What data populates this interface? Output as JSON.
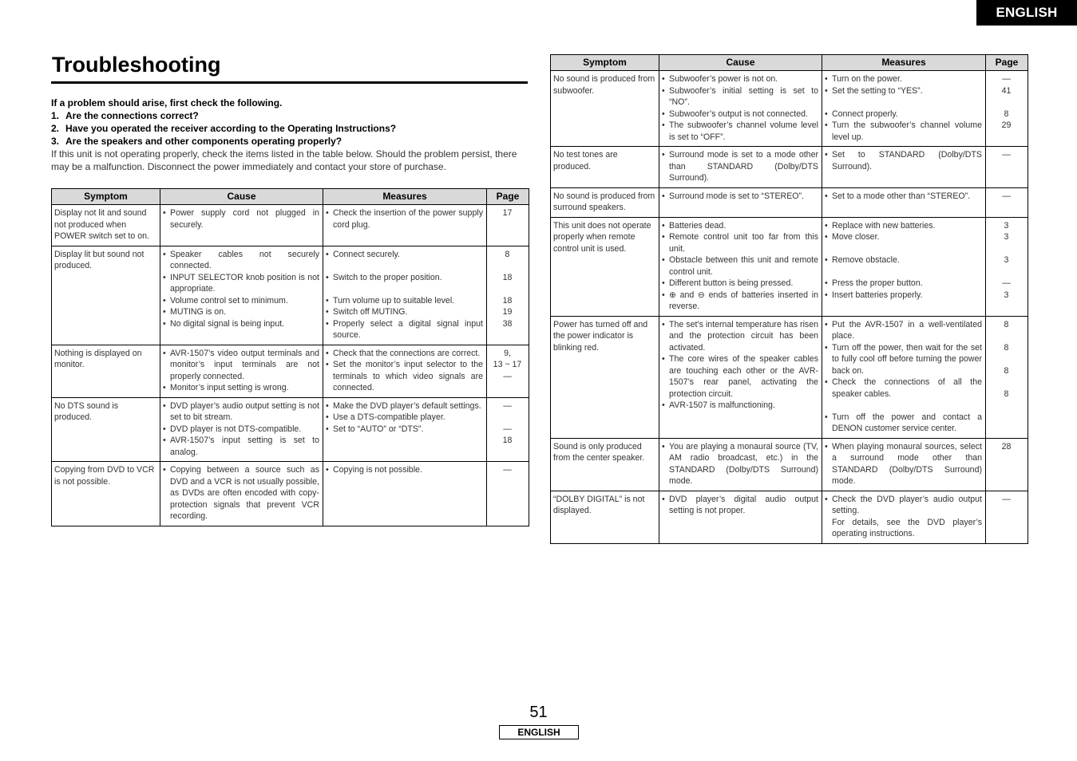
{
  "language_tab": "ENGLISH",
  "title": "Troubleshooting",
  "intro": {
    "lead": "If a problem should arise, first check the following.",
    "checks": [
      {
        "num": "1.",
        "text": "Are the connections correct?"
      },
      {
        "num": "2.",
        "text": "Have you operated the receiver according to the Operating Instructions?"
      },
      {
        "num": "3.",
        "text": "Are the speakers and other components operating properly?"
      }
    ],
    "note": "If this unit is not operating properly, check the items listed in the table below. Should the problem persist, there may be a malfunction. Disconnect the power immediately and contact your store of purchase."
  },
  "table_headers": {
    "symptom": "Symptom",
    "cause": "Cause",
    "measures": "Measures",
    "page": "Page"
  },
  "left_table": [
    {
      "symptom": "Display not lit and sound not produced when POWER switch set to on.",
      "causes": [
        "Power supply cord not plugged in securely."
      ],
      "measures": [
        "Check the insertion of the power supply cord plug."
      ],
      "pages": [
        "17"
      ]
    },
    {
      "symptom": "Display lit but sound not produced.",
      "causes": [
        "Speaker cables not securely connected.",
        "INPUT SELECTOR knob position is not appropriate.",
        "Volume control set to minimum.",
        "MUTING is on.",
        "No digital signal is being input."
      ],
      "measures": [
        "Connect securely.",
        "Switch to the proper position.",
        "Turn volume up to suitable level.",
        "Switch off MUTING.",
        "Properly select a digital signal input source."
      ],
      "pages": [
        "8",
        "18",
        "18",
        "19",
        "38"
      ]
    },
    {
      "symptom": "Nothing is displayed on monitor.",
      "causes": [
        "AVR-1507’s video output terminals and monitor’s input terminals are not properly connected.",
        "Monitor’s input setting is wrong."
      ],
      "measures": [
        "Check that the connections are correct.",
        "Set the monitor’s input selector to the terminals to which video signals are connected."
      ],
      "pages": [
        "9,",
        "13 ~ 17",
        "—"
      ]
    },
    {
      "symptom": "No DTS sound is produced.",
      "causes": [
        "DVD player’s audio output setting is not set to bit stream.",
        "DVD player is not DTS-compatible.",
        "AVR-1507’s input setting is set to analog."
      ],
      "measures": [
        "Make the DVD player’s default settings.",
        "Use a DTS-compatible player.",
        "Set to “AUTO” or “DTS”."
      ],
      "pages": [
        "—",
        "—",
        "18"
      ]
    },
    {
      "symptom": "Copying from DVD to VCR is not possible.",
      "causes": [
        "Copying between a source such as DVD and a VCR is not usually possible, as DVDs are often encoded with copy-protection signals that prevent VCR recording."
      ],
      "measures": [
        "Copying is not possible."
      ],
      "pages": [
        "—"
      ]
    }
  ],
  "right_table": [
    {
      "symptom": "No sound is produced from subwoofer.",
      "causes": [
        "Subwoofer’s power is not on.",
        "Subwoofer’s initial setting is set to “NO”.",
        "Subwoofer’s output is not connected.",
        "The subwoofer’s channel volume level is set to “OFF”."
      ],
      "measures": [
        "Turn on the power.",
        "Set the setting to “YES”.",
        "Connect properly.",
        "Turn the subwoofer’s channel volume level up."
      ],
      "pages": [
        "—",
        "41",
        "8",
        "29"
      ]
    },
    {
      "symptom": "No test tones are produced.",
      "causes": [
        "Surround mode is set to a mode other than STANDARD (Dolby/DTS Surround)."
      ],
      "measures": [
        "Set to STANDARD (Dolby/DTS Surround)."
      ],
      "pages": [
        "—"
      ]
    },
    {
      "symptom": "No sound is produced from surround speakers.",
      "causes": [
        "Surround mode is set to “STEREO”."
      ],
      "measures": [
        "Set to a mode other than “STEREO”."
      ],
      "pages": [
        "—"
      ]
    },
    {
      "symptom": "This unit does not operate properly when remote control unit is used.",
      "causes": [
        "Batteries dead.",
        "Remote control unit too far from this unit.",
        "Obstacle between this unit and remote control unit.",
        "Different button is being pressed.",
        "⊕ and ⊖ ends of batteries inserted in reverse."
      ],
      "measures": [
        "Replace with new batteries.",
        "Move closer.",
        "Remove obstacle.",
        "Press the proper button.",
        "Insert batteries properly."
      ],
      "pages": [
        "3",
        "3",
        "3",
        "—",
        "3"
      ]
    },
    {
      "symptom": "Power has turned off and the power indicator is blinking red.",
      "causes": [
        "The set’s internal temperature has risen and the protection circuit has been activated.",
        "The core wires of the speaker cables are touching each other or the AVR-1507’s rear panel, activating the protection circuit.",
        "AVR-1507 is malfunctioning."
      ],
      "measures": [
        "Put the AVR-1507 in a well-ventilated place.",
        "Turn off the power, then wait for the set to fully cool off before turning the power back on.",
        "Check the connections of all the speaker cables.",
        "Turn off the power and contact a DENON customer service center."
      ],
      "pages": [
        "8",
        "8",
        "8",
        "8"
      ]
    },
    {
      "symptom": "Sound is only produced from the center speaker.",
      "causes": [
        "You are playing a monaural source (TV, AM radio broadcast, etc.) in the STANDARD (Dolby/DTS Surround) mode."
      ],
      "measures": [
        "When playing monaural sources, select a surround mode other than STANDARD (Dolby/DTS Surround) mode."
      ],
      "pages": [
        "28"
      ]
    },
    {
      "symptom": "“DOLBY DIGITAL” is not displayed.",
      "causes": [
        "DVD player’s digital audio output setting is not proper."
      ],
      "measures": [
        "Check the DVD player’s audio output setting.",
        "For details, see the DVD player’s operating instructions."
      ],
      "pages": [
        "—"
      ]
    }
  ],
  "footer": {
    "page_number": "51",
    "language": "ENGLISH"
  }
}
